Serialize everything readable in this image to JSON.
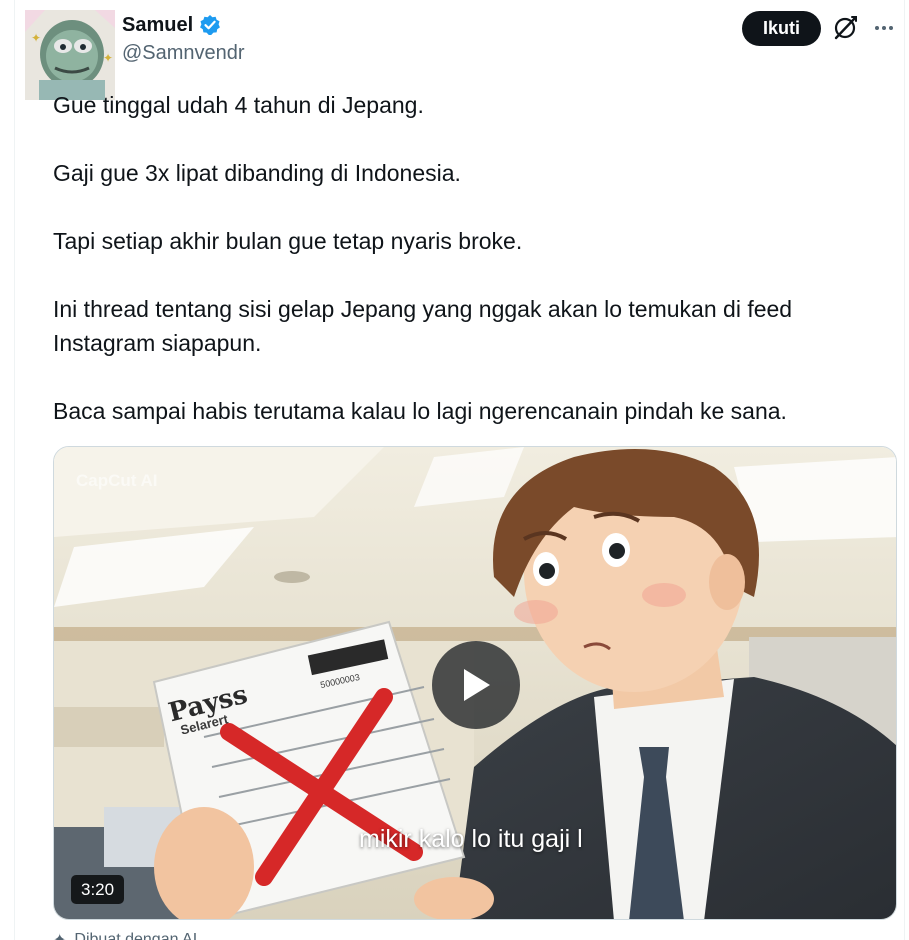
{
  "author": {
    "name": "Samuel",
    "handle": "@Samnvendr",
    "verified": true
  },
  "actions": {
    "follow_label": "Ikuti"
  },
  "tweet": {
    "paragraphs": [
      "Gue tinggal udah 4 tahun di Jepang.",
      "Gaji gue 3x lipat dibanding di Indonesia.",
      "Tapi setiap akhir bulan gue tetap nyaris broke.",
      "Ini thread tentang sisi gelap Jepang yang nggak akan lo temukan di feed Instagram siapapun.",
      "Baca sampai habis terutama kalau lo lagi ngerencanain pindah ke sana."
    ]
  },
  "media": {
    "watermark": "CapCut AI",
    "paper_title": "Payss",
    "paper_subtitle": "Selarert",
    "barcode_number": "50000003",
    "subtitle_text": "mikir kalo lo itu gaji l",
    "duration": "3:20"
  },
  "footer": {
    "hint": "Dibuat dengan AI"
  },
  "colors": {
    "accent_follow_bg": "#0f1419",
    "verified_blue": "#1d9bf0",
    "secondary_text": "#536471",
    "red_x": "#d62828"
  }
}
